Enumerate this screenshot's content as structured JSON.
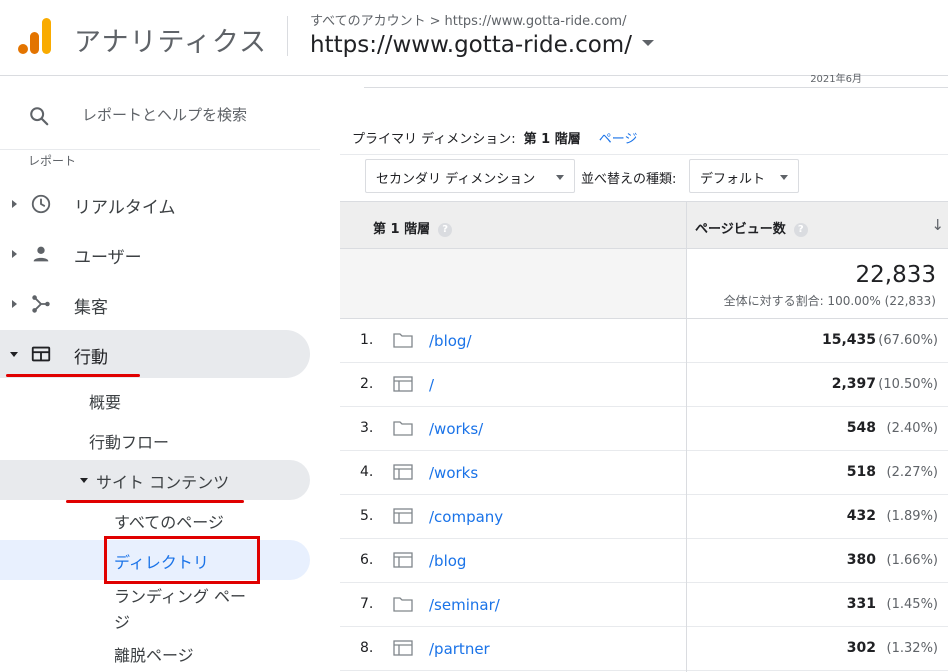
{
  "header": {
    "app_name": "アナリティクス",
    "breadcrumb": [
      "すべてのアカウント",
      "https://www.gotta-ride.com/"
    ],
    "breadcrumb_sep": ">",
    "account": "https://www.gotta-ride.com/"
  },
  "sidebar": {
    "search_label": "レポートとヘルプを検索",
    "section_label": "レポート",
    "items": [
      {
        "label": "リアルタイム",
        "icon": "clock-icon"
      },
      {
        "label": "ユーザー",
        "icon": "person-icon"
      },
      {
        "label": "集客",
        "icon": "acquisition-icon"
      },
      {
        "label": "行動",
        "icon": "behavior-icon"
      }
    ],
    "behavior_sub": {
      "overview": "概要",
      "flow": "行動フロー",
      "site_content": "サイト コンテンツ",
      "all_pages": "すべてのページ",
      "directory": "ディレクトリ",
      "landing_1": "ランディング ペー",
      "landing_2": "ジ",
      "exit": "離脱ページ"
    }
  },
  "main": {
    "top_fragment": "2021年6月",
    "primary_dim_label": "プライマリ ディメンション:",
    "primary_dim_current": "第 1 階層",
    "primary_dim_link": "ページ",
    "secondary_dim": "セカンダリ ディメンション",
    "sort_label": "並べ替えの種類:",
    "sort_value": "デフォルト",
    "col1": "第 1 階層",
    "col2": "ページビュー数",
    "help_glyph": "?",
    "sort_glyph": "↓",
    "total_value": "22,833",
    "total_sub": "全体に対する割合: 100.00% (22,833)",
    "rows": [
      {
        "idx": "1.",
        "type": "folder",
        "path": "/blog/",
        "value": "15,435",
        "pct": "(67.60%)"
      },
      {
        "idx": "2.",
        "type": "page",
        "path": "/",
        "value": "2,397",
        "pct": "(10.50%)"
      },
      {
        "idx": "3.",
        "type": "folder",
        "path": "/works/",
        "value": "548",
        "pct": "(2.40%)"
      },
      {
        "idx": "4.",
        "type": "page",
        "path": "/works",
        "value": "518",
        "pct": "(2.27%)"
      },
      {
        "idx": "5.",
        "type": "page",
        "path": "/company",
        "value": "432",
        "pct": "(1.89%)"
      },
      {
        "idx": "6.",
        "type": "page",
        "path": "/blog",
        "value": "380",
        "pct": "(1.66%)"
      },
      {
        "idx": "7.",
        "type": "folder",
        "path": "/seminar/",
        "value": "331",
        "pct": "(1.45%)"
      },
      {
        "idx": "8.",
        "type": "page",
        "path": "/partner",
        "value": "302",
        "pct": "(1.32%)"
      }
    ]
  },
  "colors": {
    "brand_orange": "#e37400",
    "brand_yellow": "#f9ab00",
    "link_blue": "#1a73e8",
    "highlight_red": "#e00000",
    "active_bg": "#e8f0fe"
  }
}
